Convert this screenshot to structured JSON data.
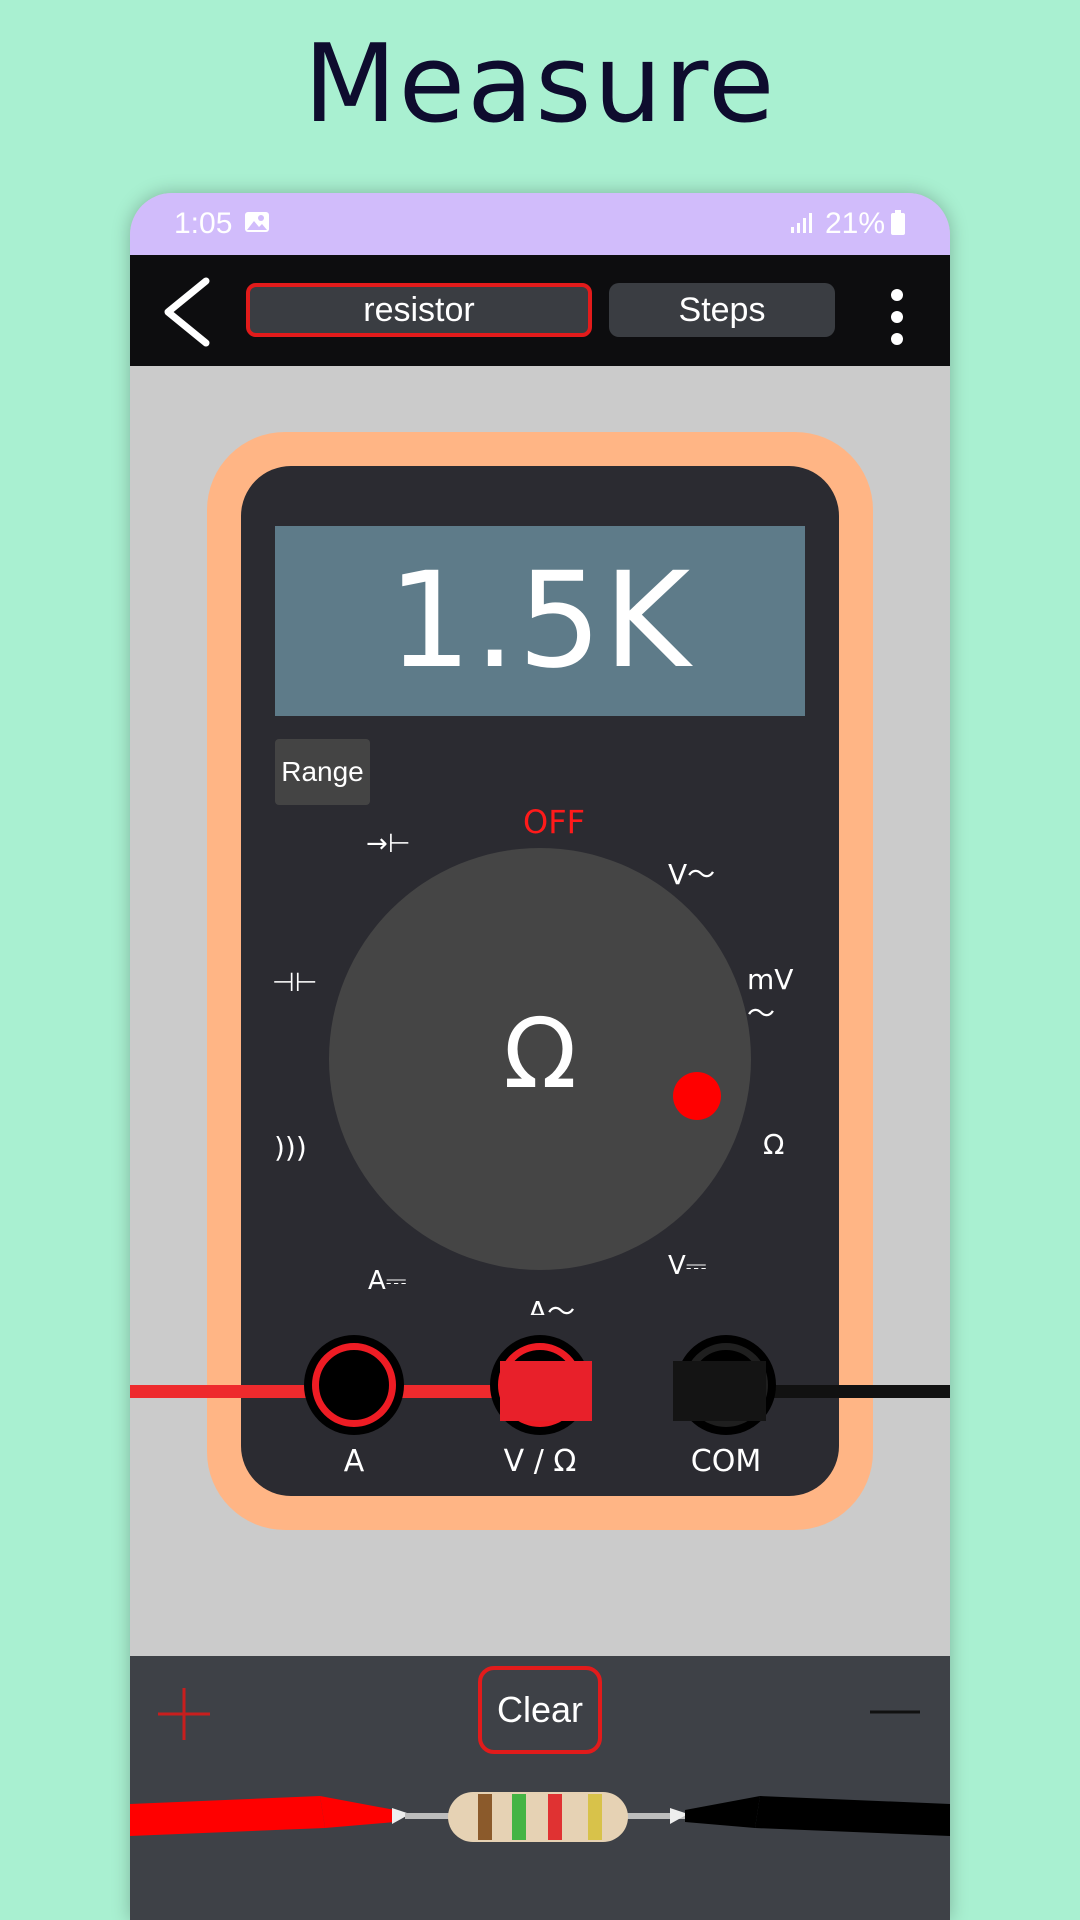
{
  "header": {
    "title": "Measure"
  },
  "status_bar": {
    "time": "1:05",
    "battery": "21%"
  },
  "app_bar": {
    "tab_active": "resistor",
    "tab_steps": "Steps"
  },
  "meter": {
    "display_value": "1.5K",
    "range_label": "Range",
    "dial_symbol": "Ω",
    "dial_labels": {
      "off": "OFF",
      "diode": "→⊢",
      "v_ac": "V〜",
      "capacitor": "⊣⊢",
      "mv_ac": "mV\n〜",
      "continuity": ")))",
      "ohm": "Ω",
      "a_dc": "A⎓",
      "v_dc": "V⎓",
      "a_ac": "A〜"
    },
    "jacks": [
      {
        "label": "A"
      },
      {
        "label": "V / Ω"
      },
      {
        "label": "COM"
      }
    ]
  },
  "controls": {
    "clear_label": "Clear"
  },
  "colors": {
    "background": "#a9f0d1",
    "accent_red": "#e21b1b",
    "meter_casing": "#ffb585",
    "display": "#5e7b89"
  },
  "icons": [
    "back-arrow-icon",
    "more-vert-icon",
    "plus-icon",
    "minus-icon",
    "image-icon",
    "signal-icon",
    "battery-icon"
  ]
}
